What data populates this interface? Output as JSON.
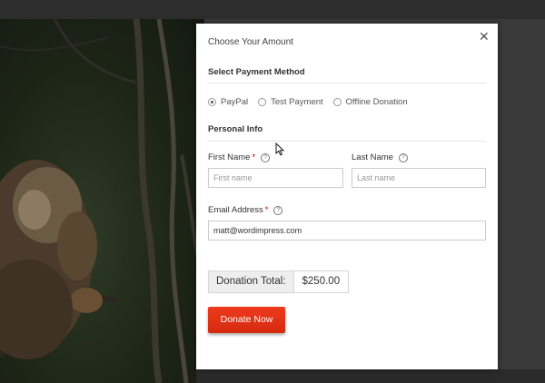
{
  "modal": {
    "title": "Choose Your Amount",
    "close_icon": "close-icon",
    "payment": {
      "heading": "Select Payment Method",
      "options": [
        {
          "label": "PayPal",
          "checked": true
        },
        {
          "label": "Test Payment",
          "checked": false
        },
        {
          "label": "Offline Donation",
          "checked": false
        }
      ]
    },
    "personal": {
      "heading": "Personal Info",
      "first_name": {
        "label": "First Name",
        "required": "*",
        "placeholder": "First name",
        "value": ""
      },
      "last_name": {
        "label": "Last Name",
        "placeholder": "Last name",
        "value": ""
      },
      "email": {
        "label": "Email Address",
        "required": "*",
        "value": "matt@wordimpress.com"
      },
      "help_glyph": "?"
    },
    "total": {
      "label": "Donation Total:",
      "value": "$250.00"
    },
    "donate_label": "Donate Now"
  },
  "colors": {
    "accent": "#e2351a",
    "background_overlay": "#3a3a3a"
  },
  "icons": [
    "close-icon",
    "help-icon",
    "radio-icon",
    "mouse-cursor-icon"
  ]
}
